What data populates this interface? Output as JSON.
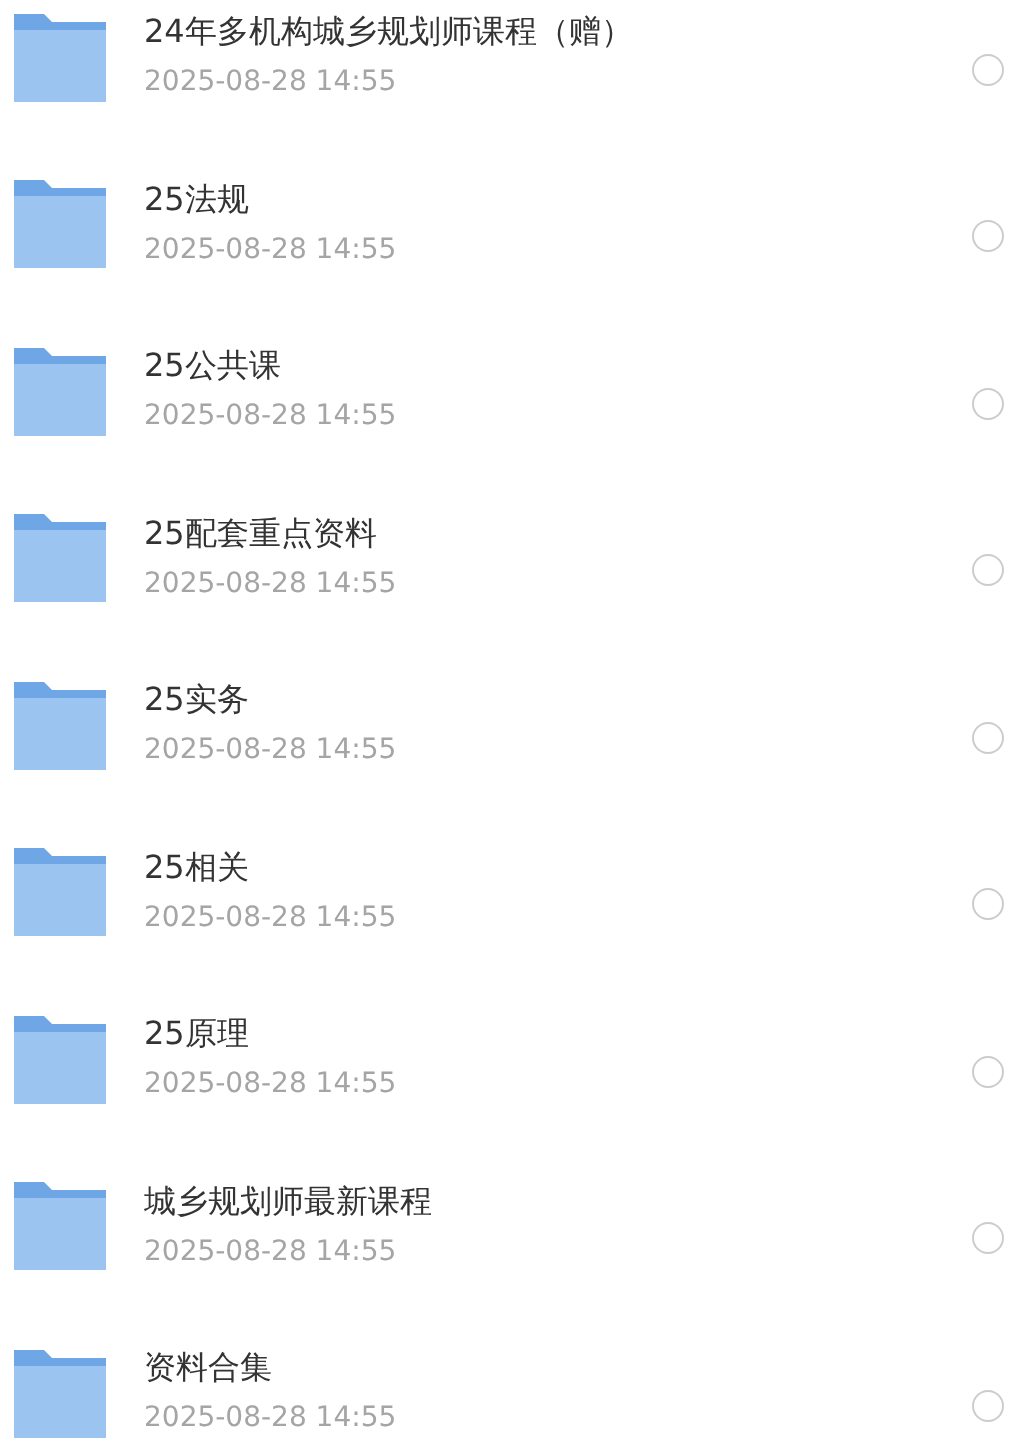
{
  "files": [
    {
      "name": "24年多机构城乡规划师课程（赠）",
      "date": "2025-08-28 14:55",
      "selected": false
    },
    {
      "name": "25法规",
      "date": "2025-08-28 14:55",
      "selected": false
    },
    {
      "name": "25公共课",
      "date": "2025-08-28 14:55",
      "selected": false
    },
    {
      "name": "25配套重点资料",
      "date": "2025-08-28 14:55",
      "selected": false
    },
    {
      "name": "25实务",
      "date": "2025-08-28 14:55",
      "selected": false
    },
    {
      "name": "25相关",
      "date": "2025-08-28 14:55",
      "selected": false
    },
    {
      "name": "25原理",
      "date": "2025-08-28 14:55",
      "selected": false
    },
    {
      "name": "城乡规划师最新课程",
      "date": "2025-08-28 14:55",
      "selected": false
    },
    {
      "name": "资料合集",
      "date": "2025-08-28 14:55",
      "selected": false
    }
  ]
}
